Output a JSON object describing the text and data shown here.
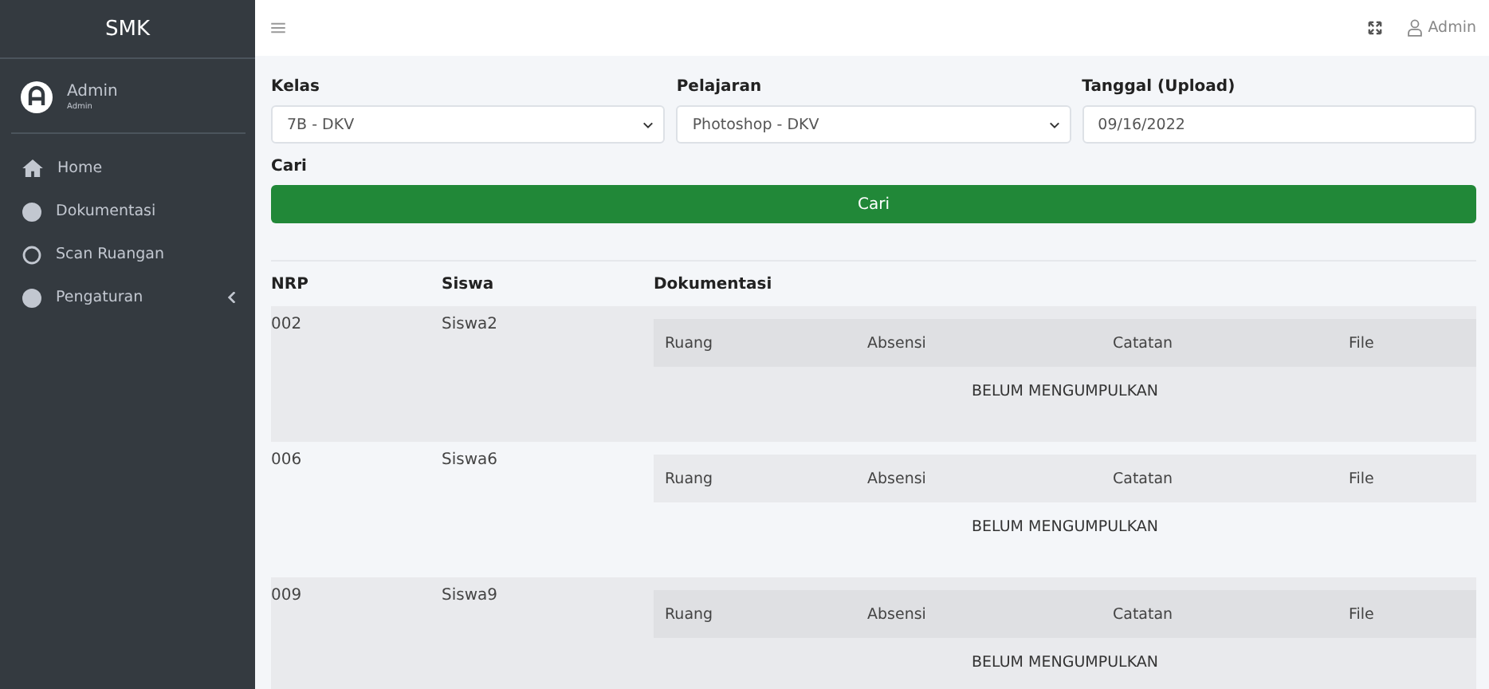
{
  "sidebar": {
    "brand": "SMK",
    "user": {
      "name": "Admin",
      "role": "Admin"
    },
    "items": [
      {
        "label": "Home",
        "kind": "home",
        "submenu": false
      },
      {
        "label": "Dokumentasi",
        "kind": "dot",
        "submenu": false
      },
      {
        "label": "Scan Ruangan",
        "kind": "ring",
        "submenu": false
      },
      {
        "label": "Pengaturan",
        "kind": "dot",
        "submenu": true
      }
    ]
  },
  "topbar": {
    "user": "Admin"
  },
  "filters": [
    {
      "label": "Kelas",
      "kind": "select",
      "value": "7B - DKV"
    },
    {
      "label": "Pelajaran",
      "kind": "select",
      "value": "Photoshop - DKV"
    },
    {
      "label": "Tanggal (Upload)",
      "kind": "date",
      "value": "09/16/2022"
    }
  ],
  "search": {
    "label": "Cari",
    "button": "Cari"
  },
  "table": {
    "columns": [
      "NRP",
      "Siswa",
      "Dokumentasi"
    ],
    "rows": [
      {
        "nrp": "002",
        "siswa": "Siswa2",
        "doc_columns": [
          "Ruang",
          "Absensi",
          "Catatan",
          "File"
        ],
        "status": "BELUM MENGUMPULKAN"
      },
      {
        "nrp": "006",
        "siswa": "Siswa6",
        "doc_columns": [
          "Ruang",
          "Absensi",
          "Catatan",
          "File"
        ],
        "status": "BELUM MENGUMPULKAN"
      },
      {
        "nrp": "009",
        "siswa": "Siswa9",
        "doc_columns": [
          "Ruang",
          "Absensi",
          "Catatan",
          "File"
        ],
        "status": "BELUM MENGUMPULKAN"
      }
    ]
  }
}
